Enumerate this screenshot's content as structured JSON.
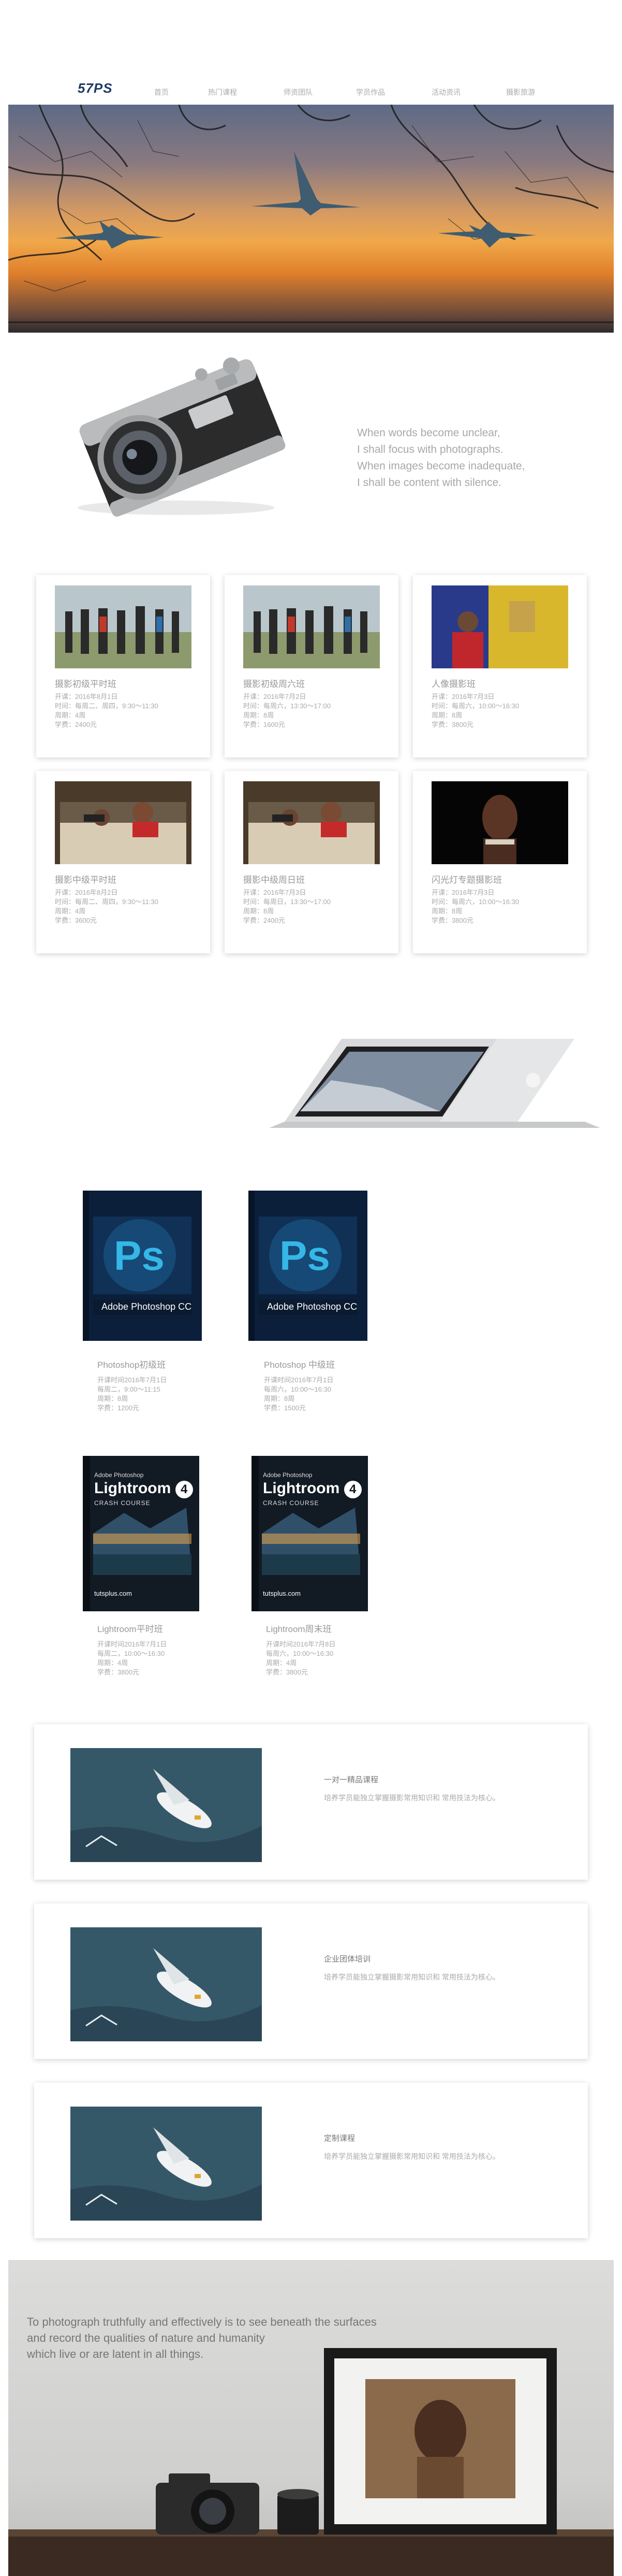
{
  "nav": {
    "logo": "57PS",
    "links": [
      "首页",
      "热门课程",
      "师资团队",
      "学员作品",
      "活动资讯",
      "摄影旅游"
    ]
  },
  "quote": {
    "lines": [
      "When words become unclear,",
      "I shall focus with photographs.",
      " When images become inadequate,",
      "I shall be content with silence."
    ]
  },
  "courses": [
    {
      "title": "摄影初级平时班",
      "lines": [
        "开课：2016年8月1日",
        "时间：每周二、周四，9:30～11:30",
        "周期：4周",
        "学费：2400元"
      ]
    },
    {
      "title": "摄影初级周六班",
      "lines": [
        "开课：2016年7月2日",
        "时间：每周六，13:30～17:00",
        "周期：8周",
        "学费：1600元"
      ]
    },
    {
      "title": "人像摄影班",
      "lines": [
        "开课：2016年7月3日",
        "时间：每周六，10:00～16:30",
        "周期：8周",
        "学费：3800元"
      ]
    },
    {
      "title": "摄影中级平时班",
      "lines": [
        "开课：2016年8月2日",
        "时间：每周二、周四，9:30～11:30",
        "周期：4周",
        "学费：3600元"
      ]
    },
    {
      "title": "摄影中级周日班",
      "lines": [
        "开课：2016年7月3日",
        "时间：每周日，13:30～17:00",
        "周期：8周",
        "学费：2400元"
      ]
    },
    {
      "title": "闪光灯专题摄影班",
      "lines": [
        "开课：2016年7月3日",
        "时间：每周六，10:00～16:30",
        "周期：8周",
        "学费：3800元"
      ]
    }
  ],
  "software": [
    {
      "title": "Photoshop初级班",
      "lines": [
        "开课时间2016年7月1日",
        "每周二，9:00～11:15",
        "周期：8周",
        "学费：1200元"
      ]
    },
    {
      "title": "Photoshop 中级班",
      "lines": [
        "开课时间2016年7月1日",
        "每周六，10:00～16:30",
        "周期：8周",
        "学费：1500元"
      ]
    },
    {
      "title": "Lightroom平时班",
      "lines": [
        "开课时间2016年7月1日",
        "每周二，10:00～16:30",
        "周期：4周",
        "学费：3800元"
      ]
    },
    {
      "title": "Lightroom周末班",
      "lines": [
        "开课时间2016年7月8日",
        "每周六，10:00～16:30",
        "周期：4周",
        "学费：3800元"
      ]
    }
  ],
  "boxes": {
    "ps_label": "Photoshop CC",
    "ps_brand": "Adobe",
    "ps_badge": "Ps",
    "lr_top": "Adobe Photoshop",
    "lr_name": "Lightroom",
    "lr_version": "4",
    "lr_sub": "CRASH COURSE",
    "lr_site": "tutsplus.com"
  },
  "services": [
    {
      "title": "一对一精品课程",
      "desc": "培养学员能独立掌握摄影常用知识和 常用技法为核心。"
    },
    {
      "title": "企业团体培训",
      "desc": "培养学员能独立掌握摄影常用知识和 常用技法为核心。"
    },
    {
      "title": "定制课程",
      "desc": "培养学员能独立掌握摄影常用知识和 常用技法为核心。"
    }
  ],
  "footer": {
    "lines": [
      "To photograph truthfully and effectively is to see beneath the surfaces",
      "and record the qualities of nature and humanity",
      "which live or are latent in all things."
    ]
  },
  "colors": {
    "logo": "#1e3b6a",
    "text_gray": "#999999",
    "ps_box": "#0c1f3a",
    "ps_cyan": "#35b7e8"
  }
}
